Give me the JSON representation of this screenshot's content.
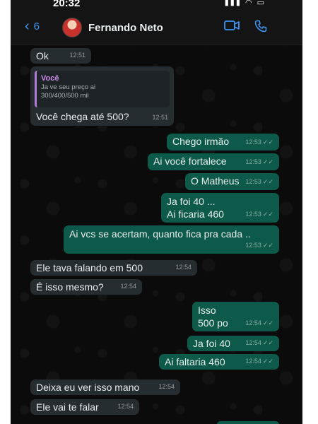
{
  "status_bar": {
    "time": "20:32"
  },
  "header": {
    "back_count": "6",
    "contact_name": "Fernando Neto"
  },
  "messages": [
    {
      "dir": "in",
      "text": "Ok",
      "time": "12:51"
    },
    {
      "dir": "in",
      "reply_to": {
        "author": "Você",
        "text": "Ja ve seu preço ai 300/400/500 mil"
      },
      "text": "Você chega até 500?",
      "time": "12:51"
    },
    {
      "dir": "out",
      "text": "Chego irmão",
      "time": "12:53"
    },
    {
      "dir": "out",
      "text": "Ai você fortalece",
      "time": "12:53"
    },
    {
      "dir": "out",
      "text": "O Matheus",
      "time": "12:53"
    },
    {
      "dir": "out",
      "lines": [
        "Ja foi 40 ...",
        "Ai ficaria 460"
      ],
      "time": "12:53"
    },
    {
      "dir": "out",
      "text": "Ai vcs se acertam, quanto fica pra cada ..",
      "time": "12:53"
    },
    {
      "dir": "in",
      "text": "Ele tava falando em 500",
      "time": "12:54"
    },
    {
      "dir": "in",
      "text": "É isso mesmo?",
      "time": "12:54"
    },
    {
      "dir": "out",
      "lines": [
        "Isso",
        "500 po"
      ],
      "time": "12:54"
    },
    {
      "dir": "out",
      "text": "Ja foi 40",
      "time": "12:54"
    },
    {
      "dir": "out",
      "text": "Ai faltaria 460",
      "time": "12:54"
    },
    {
      "dir": "in",
      "text": "Deixa eu ver isso mano",
      "time": "12:54"
    },
    {
      "dir": "in",
      "text": "Ele vai te falar",
      "time": "12:54"
    }
  ],
  "colors": {
    "incoming": "#262d31",
    "outgoing": "#0d5a4a",
    "accent": "#3e96f4",
    "background": "#0b0b0b"
  },
  "icons": [
    "chevron-left-icon",
    "video-call-icon",
    "phone-call-icon",
    "double-check-icon"
  ]
}
